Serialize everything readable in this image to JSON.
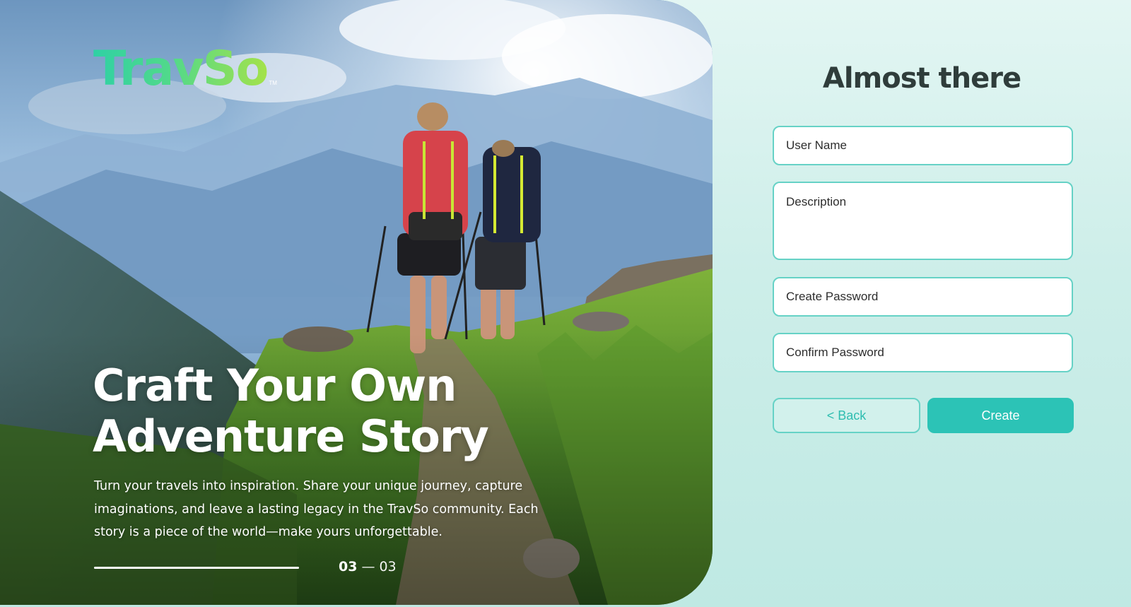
{
  "brand": {
    "logo_text": "TravSo",
    "trademark": "TM"
  },
  "hero": {
    "headline_line1": "Craft Your Own",
    "headline_line2": "Adventure Story",
    "description": "Turn your travels into inspiration. Share your unique journey, capture imaginations, and leave a lasting legacy in the TravSo community. Each story is a piece of the world—make yours unforgettable.",
    "step_progress": 1.0,
    "pager": {
      "current": "03",
      "separator": "—",
      "total": "03"
    }
  },
  "form": {
    "title": "Almost there",
    "username": {
      "placeholder": "User Name",
      "value": ""
    },
    "description": {
      "placeholder": "Description",
      "value": ""
    },
    "password": {
      "placeholder": "Create Password",
      "value": ""
    },
    "confirm_password": {
      "placeholder": "Confirm Password",
      "value": ""
    },
    "back_label": "< Back",
    "create_label": "Create"
  },
  "colors": {
    "accent": "#2cc3b6",
    "field_border": "#66d2c6",
    "title_text": "#2f3d3b",
    "panel_bg": "#d4f1ec"
  }
}
